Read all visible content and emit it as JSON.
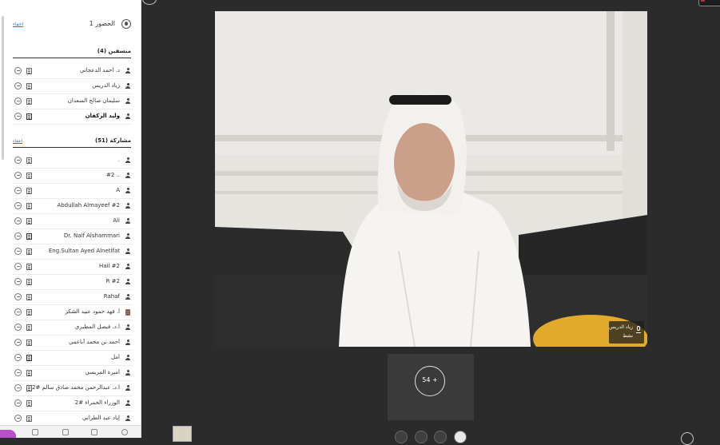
{
  "sidebar": {
    "header_title": "الحضور 1",
    "header_link": "اخفاء",
    "hosts": {
      "label": "منسقين (4)",
      "items": [
        {
          "name": "د. أحمد الدعجاني"
        },
        {
          "name": "زياد الدريس"
        },
        {
          "name": "سليمان صالح السعدان"
        },
        {
          "name": "وليد الركفان"
        }
      ]
    },
    "participants": {
      "label": "مشاركة (51)",
      "link": "اخفاء",
      "items": [
        {
          "name": "."
        },
        {
          "name": "#2 .."
        },
        {
          "name": "A"
        },
        {
          "name": "Abdullah Almayeef #2"
        },
        {
          "name": "Ali"
        },
        {
          "name": "Dr. Naif Alshammari"
        },
        {
          "name": "Eng.Sultan Ayed Alnetifat"
        },
        {
          "name": "Hail #2"
        },
        {
          "name": "R #2"
        },
        {
          "name": "Rahaf"
        },
        {
          "name": "أ. فهد حمود عبيد الشكر"
        },
        {
          "name": "أ.د. فيصل المطيري"
        },
        {
          "name": "أحمد بن محمد آباعمي"
        },
        {
          "name": "أمل"
        },
        {
          "name": "أميرة المريسي"
        },
        {
          "name": "أ.د. عبدالرحمن محمد صادق سالم #2"
        },
        {
          "name": "الوزراء الحمراء #2"
        },
        {
          "name": "إياد عبد الطراني"
        }
      ]
    }
  },
  "video": {
    "speaker_name": "زياد الدريس",
    "speaker_state": "نشط"
  },
  "others_tile": {
    "count_label": "54 +"
  },
  "colors": {
    "link": "#2a6fd6",
    "accent_purple": "#b84ec9",
    "stage_bg": "#2b2b2b"
  }
}
